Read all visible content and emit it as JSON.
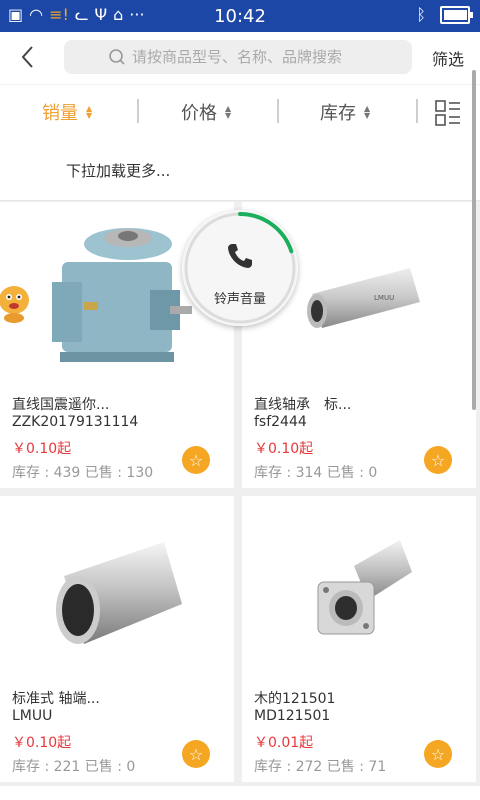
{
  "status_bar": {
    "time": "10:42",
    "dots": "···"
  },
  "header": {
    "search_placeholder": "请按商品型号、名称、品牌搜索",
    "filter_label": "筛选"
  },
  "sort_tabs": [
    {
      "label": "销量",
      "active": true
    },
    {
      "label": "价格",
      "active": false
    },
    {
      "label": "库存",
      "active": false
    }
  ],
  "pull_text": "下拉加载更多...",
  "ringer_overlay": {
    "label": "铃声音量",
    "level": 0.2
  },
  "products": [
    {
      "name": "直线国震遥你...",
      "model": "ZZK20179131114",
      "price": "￥0.10起",
      "stock": "库存 : 439 已售 : 130"
    },
    {
      "name": "直线轴承　标...",
      "model": "fsf2444",
      "price": "￥0.10起",
      "stock": "库存 : 314 已售 : 0"
    },
    {
      "name": "标准式 轴端...",
      "model": "LMUU",
      "price": "￥0.10起",
      "stock": "库存 : 221 已售 : 0"
    },
    {
      "name": "木的121501",
      "model": "MD121501",
      "price": "￥0.01起",
      "stock": "库存 : 272 已售 : 71"
    }
  ],
  "colors": {
    "status_bar": "#1c47a6",
    "accent": "#f0a030",
    "price": "#e5393b",
    "fav": "#f5a623"
  }
}
